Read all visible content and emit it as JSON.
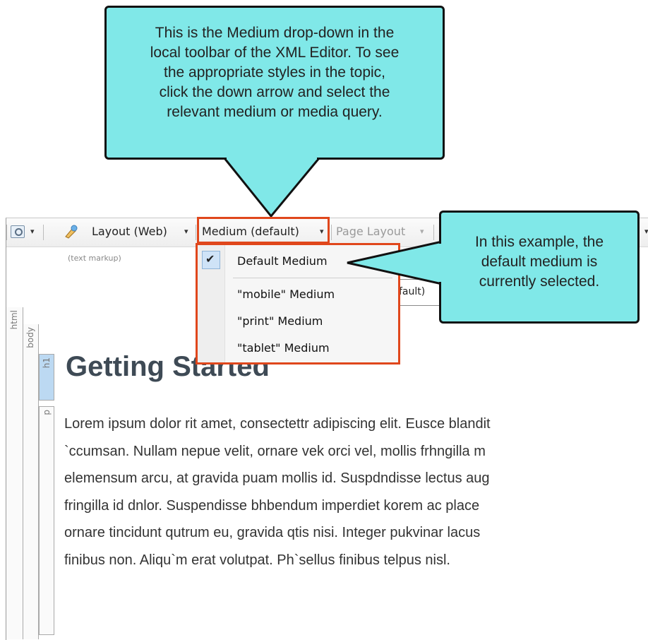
{
  "callouts": {
    "top": [
      "This is the Medium drop-down in the",
      "local toolbar of the XML Editor. To see",
      "the appropriate styles in the topic,",
      "click the down arrow and select the",
      "relevant medium or media query."
    ],
    "right": [
      "In this example, the",
      "default medium is",
      "currently selected."
    ],
    "fill_color": "#80e8e8"
  },
  "toolbar": {
    "layout_label": "Layout (Web)",
    "medium_label": "Medium (default)",
    "page_layout_label": "Page Layout",
    "arrow": "▾",
    "text_markup": "(text markup)"
  },
  "medium_dropdown": {
    "items": [
      {
        "label": "Default Medium",
        "checked": true
      },
      {
        "label": "\"mobile\" Medium",
        "checked": false
      },
      {
        "label": "\"print\" Medium",
        "checked": false
      },
      {
        "label": "\"tablet\" Medium",
        "checked": false
      }
    ],
    "check_mark": "✔",
    "highlight_color": "#e0471c"
  },
  "obscured_text": "fault)",
  "structure_bars": {
    "html": "html",
    "body": "body",
    "h1": "h1",
    "p": "p"
  },
  "content": {
    "heading": "Getting Started",
    "paragraph_lines": [
      "Lorem ipsum dolor rit amet, consectettr adipiscing elit. Eusce blandit",
      "`ccumsan. Nullam nepue velit, ornare vek orci vel, mollis frhngilla m",
      "elemensum arcu, at gravida puam mollis id. Suspdndisse lectus aug",
      "fringilla id dnlor. Suspendisse bhbendum imperdiet korem ac place",
      "ornare tincidunt qutrum eu, gravida qtis nisi. Integer pukvinar lacus",
      "finibus non. Aliqu`m erat volutpat. Ph`sellus finibus telpus nisl."
    ]
  }
}
